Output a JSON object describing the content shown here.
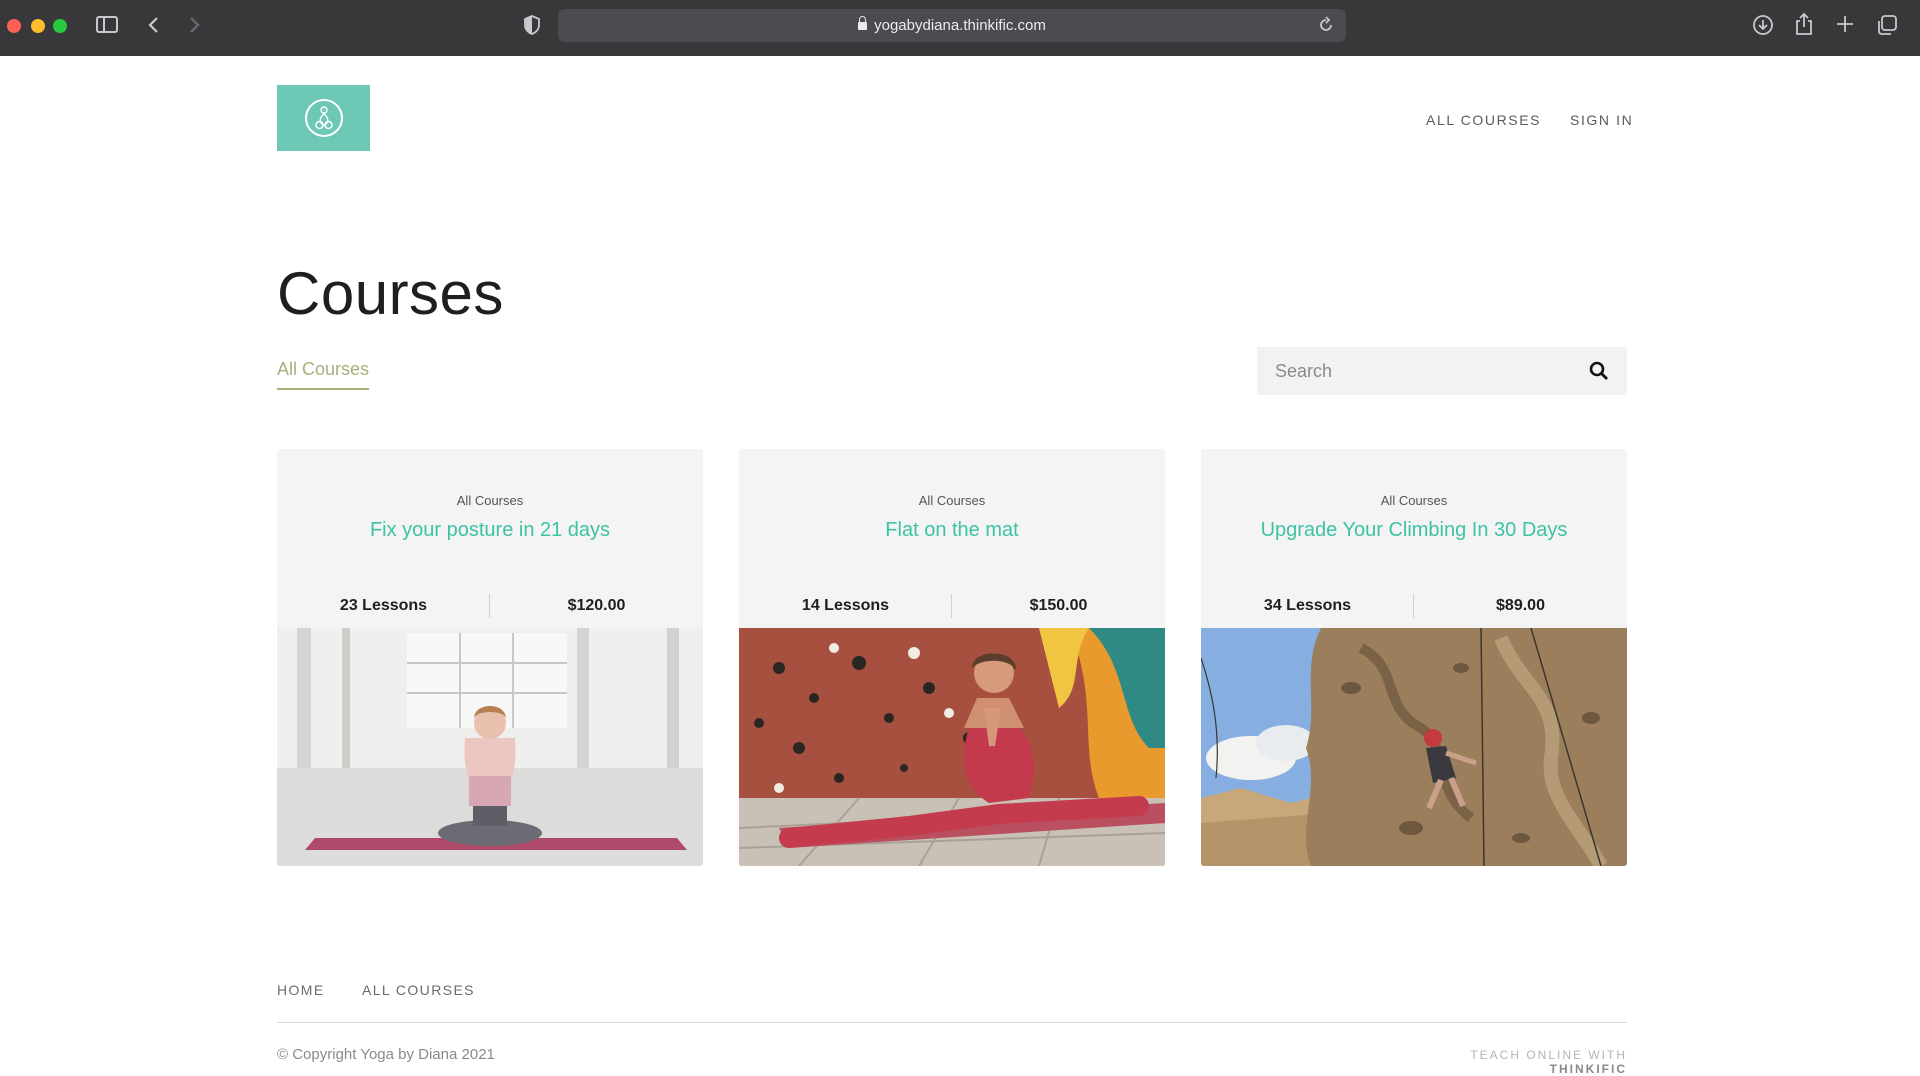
{
  "browser": {
    "url": "yogabydiana.thinkific.com"
  },
  "header": {
    "nav": {
      "all_courses": "ALL COURSES",
      "sign_in": "SIGN IN"
    }
  },
  "main": {
    "title": "Courses",
    "filter_tab": "All Courses",
    "search": {
      "placeholder": "Search",
      "value": ""
    },
    "courses": [
      {
        "category": "All Courses",
        "title": "Fix your posture in 21 days",
        "lessons": "23 Lessons",
        "price": "$120.00"
      },
      {
        "category": "All Courses",
        "title": "Flat on the mat",
        "lessons": "14 Lessons",
        "price": "$150.00"
      },
      {
        "category": "All Courses",
        "title": "Upgrade Your Climbing In 30 Days",
        "lessons": "34 Lessons",
        "price": "$89.00"
      }
    ]
  },
  "footer": {
    "nav": {
      "home": "HOME",
      "all_courses": "ALL COURSES"
    },
    "copyright": "© Copyright Yoga by Diana 2021",
    "powered_prefix": "TEACH ONLINE WITH",
    "powered_brand": "THINKIFIC"
  },
  "colors": {
    "brand_teal": "#6dc9b5",
    "course_title": "#3dc3a4",
    "tab_accent": "#a6b07c"
  },
  "icons": {
    "window_controls": [
      "close",
      "minimize",
      "maximize"
    ],
    "toolbar_left": [
      "sidebar-icon",
      "back-icon",
      "forward-icon",
      "shield-icon"
    ],
    "toolbar_right": [
      "download-icon",
      "share-icon",
      "new-tab-icon",
      "tabs-overview-icon"
    ],
    "search": "search-icon"
  }
}
